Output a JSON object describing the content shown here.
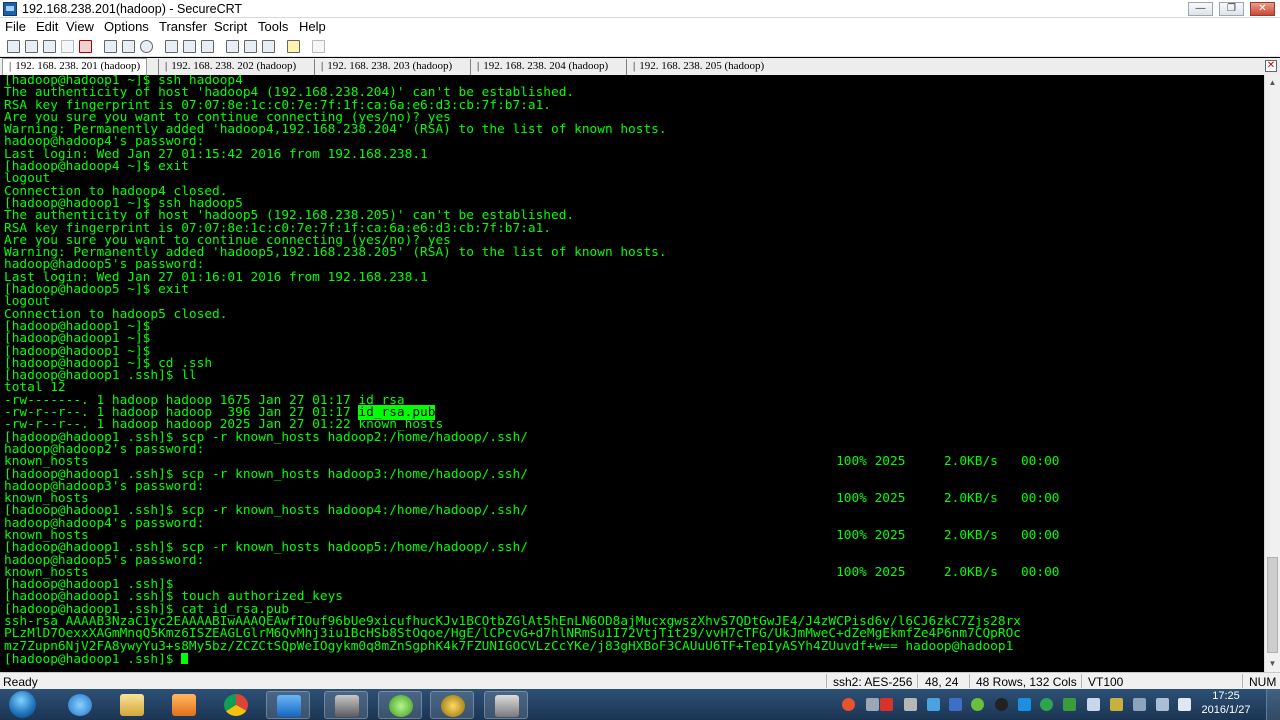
{
  "window": {
    "title": "192.168.238.201(hadoop) - SecureCRT"
  },
  "menu": [
    "File",
    "Edit",
    "View",
    "Options",
    "Transfer",
    "Script",
    "Tools",
    "Help"
  ],
  "tabs": [
    {
      "label": "192. 168. 238. 201 (hadoop)",
      "active": true
    },
    {
      "label": "192. 168. 238. 202 (hadoop)",
      "active": false
    },
    {
      "label": "192. 168. 238. 203 (hadoop)",
      "active": false
    },
    {
      "label": "192. 168. 238. 204 (hadoop)",
      "active": false
    },
    {
      "label": "192. 168. 238. 205 (hadoop)",
      "active": false
    }
  ],
  "terminal": {
    "lines": [
      "[hadoop@hadoop1 ~]$ ssh hadoop4",
      "The authenticity of host 'hadoop4 (192.168.238.204)' can't be established.",
      "RSA key fingerprint is 07:07:8e:1c:c0:7e:7f:1f:ca:6a:e6:d3:cb:7f:b7:a1.",
      "Are you sure you want to continue connecting (yes/no)? yes",
      "Warning: Permanently added 'hadoop4,192.168.238.204' (RSA) to the list of known hosts.",
      "hadoop@hadoop4's password:",
      "Last login: Wed Jan 27 01:15:42 2016 from 192.168.238.1",
      "[hadoop@hadoop4 ~]$ exit",
      "logout",
      "Connection to hadoop4 closed.",
      "[hadoop@hadoop1 ~]$ ssh hadoop5",
      "The authenticity of host 'hadoop5 (192.168.238.205)' can't be established.",
      "RSA key fingerprint is 07:07:8e:1c:c0:7e:7f:1f:ca:6a:e6:d3:cb:7f:b7:a1.",
      "Are you sure you want to continue connecting (yes/no)? yes",
      "Warning: Permanently added 'hadoop5,192.168.238.205' (RSA) to the list of known hosts.",
      "hadoop@hadoop5's password:",
      "Last login: Wed Jan 27 01:16:01 2016 from 192.168.238.1",
      "[hadoop@hadoop5 ~]$ exit",
      "logout",
      "Connection to hadoop5 closed.",
      "[hadoop@hadoop1 ~]$",
      "[hadoop@hadoop1 ~]$",
      "[hadoop@hadoop1 ~]$",
      "[hadoop@hadoop1 ~]$ cd .ssh",
      "[hadoop@hadoop1 .ssh]$ ll",
      "total 12",
      "-rw-------. 1 hadoop hadoop 1675 Jan 27 01:17 id_rsa",
      "-rw-r--r--. 1 hadoop hadoop  396 Jan 27 01:17 ",
      "-rw-r--r--. 1 hadoop hadoop 2025 Jan 27 01:22 known_hosts",
      "[hadoop@hadoop1 .ssh]$ scp -r known_hosts hadoop2:/home/hadoop/.ssh/",
      "hadoop@hadoop2's password:",
      "known_hosts                                                                                                 100% 2025     2.0KB/s   00:00",
      "[hadoop@hadoop1 .ssh]$ scp -r known_hosts hadoop3:/home/hadoop/.ssh/",
      "hadoop@hadoop3's password:",
      "known_hosts                                                                                                 100% 2025     2.0KB/s   00:00",
      "[hadoop@hadoop1 .ssh]$ scp -r known_hosts hadoop4:/home/hadoop/.ssh/",
      "hadoop@hadoop4's password:",
      "known_hosts                                                                                                 100% 2025     2.0KB/s   00:00",
      "[hadoop@hadoop1 .ssh]$ scp -r known_hosts hadoop5:/home/hadoop/.ssh/",
      "hadoop@hadoop5's password:",
      "known_hosts                                                                                                 100% 2025     2.0KB/s   00:00",
      "[hadoop@hadoop1 .ssh]$",
      "[hadoop@hadoop1 .ssh]$ touch authorized_keys",
      "[hadoop@hadoop1 .ssh]$ cat id_rsa.pub",
      "ssh-rsa AAAAB3NzaC1yc2EAAAABIwAAAQEAwfIOuf96bUe9xicufhucKJv1BCOtbZGlAt5hEnLN6OD8ajMucxgwszXhvS7QDtGwJE4/J4zWCPisd6v/l6CJ6zkC7Zjs28rx",
      "PLzMlD7OexxXAGmMnqQ5Kmz6ISZEAGLGlrM6QvMhj3iu1BcHSb8StOqoe/HgE/lCPcvG+d7hlNRmSu1I72VtjTit29/vvH7cTFG/UkJmMweC+dZeMgEkmfZe4P6nm7CQpROc",
      "mz7Zupn6NjV2FA8ywyYu3+s8My5bz/ZCZCtSQpWeIOgykm0q8mZnSgphK4k7FZUNIGOCVLzCcYKe/j83gHXBoF3CAUuU6TF+TepIyASYh4ZUuvdf+w== hadoop@hadoop1",
      "[hadoop@hadoop1 .ssh]$ "
    ],
    "highlighted_file": "id_rsa.pub",
    "highlight_line_index": 27,
    "cursor_line_index": 47
  },
  "status": {
    "ready": "Ready",
    "protocol": "ssh2: AES-256",
    "position": "48, 24",
    "size": "48 Rows, 132 Cols",
    "terminal_type": "VT100",
    "numlock": "NUM"
  },
  "clock": {
    "time": "17:25",
    "date": "2016/1/27"
  },
  "colors": {
    "terminal_fg": "#00ff00",
    "terminal_bg": "#000000",
    "taskbar": "#24456b"
  },
  "icons": {
    "toolbar": [
      "connect-icon",
      "quick-connect-icon",
      "connect-tab-icon",
      "reconnect-icon",
      "disconnect-icon",
      "copy-icon",
      "paste-icon",
      "copy-paste-icon",
      "find-icon",
      "print-icon",
      "print-selection-icon",
      "printer-icon",
      "session-options-icon",
      "global-options-icon",
      "keymap-icon",
      "help-icon",
      "sftp-icon"
    ],
    "taskbar": [
      "start-orb",
      "internet-explorer-icon",
      "file-explorer-icon",
      "media-player-icon",
      "chrome-icon",
      "outlook-icon",
      "securecrt-icon",
      "vmware-icon",
      "app-icon",
      "remote-desktop-icon"
    ]
  }
}
